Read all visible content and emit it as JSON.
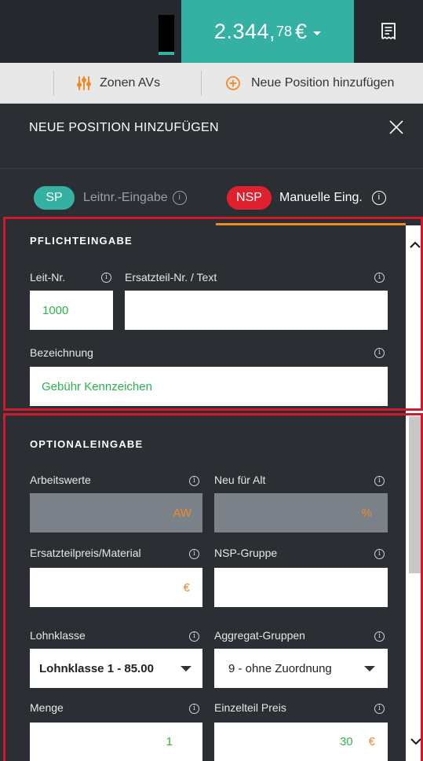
{
  "header": {
    "total_main": "2.344,",
    "total_cents": "78",
    "total_currency": "€"
  },
  "toolbar": {
    "zones_label": "Zonen AVs",
    "add_position_label": "Neue Position hinzufügen"
  },
  "panel": {
    "title": "NEUE POSITION HINZUFÜGEN"
  },
  "modes": {
    "sp_badge": "SP",
    "sp_label": "Leitnr.-Eingabe",
    "nsp_badge": "NSP",
    "nsp_label": "Manuelle Eing.",
    "info_glyph": "i"
  },
  "required": {
    "title": "PFLICHTEINGABE",
    "leitnr_label": "Leit-Nr.",
    "leitnr_value": "1000",
    "ersatzteil_label": "Ersatzteil-Nr. / Text",
    "ersatzteil_value": "",
    "bezeichnung_label": "Bezeichnung",
    "bezeichnung_value": "Gebühr Kennzeichen"
  },
  "optional": {
    "title": "OPTIONALEINGABE",
    "arbeitswerte_label": "Arbeitswerte",
    "arbeitswerte_unit": "AW",
    "neufueralt_label": "Neu für Alt",
    "neufueralt_unit": "%",
    "ersatzteilpreis_label": "Ersatzteilpreis/Material",
    "ersatzteilpreis_unit": "€",
    "nspgruppe_label": "NSP-Gruppe",
    "lohnklasse_label": "Lohnklasse",
    "lohnklasse_value": "Lohnklasse 1 - 85.00",
    "aggregat_label": "Aggregat-Gruppen",
    "aggregat_value": "9 - ohne Zuordnung",
    "menge_label": "Menge",
    "menge_value": "1",
    "einzelteil_label": "Einzelteil Preis",
    "einzelteil_value": "30",
    "einzelteil_unit": "€"
  },
  "colors": {
    "teal": "#34b1a3",
    "nsp_red": "#e0202f",
    "orange": "#f08a24",
    "green_text": "#28b34a",
    "frame_red": "#d0192a"
  },
  "icons": {
    "receipt": "receipt-icon",
    "sliders": "sliders-icon",
    "plus_circle": "plus-circle-icon",
    "close": "close-icon",
    "info": "info-icon"
  }
}
